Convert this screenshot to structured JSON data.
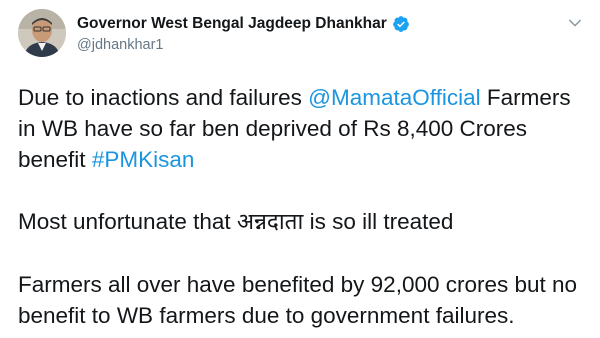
{
  "author": {
    "display_name": "Governor West Bengal Jagdeep Dhankhar",
    "handle": "@jdhankhar1",
    "verified": true
  },
  "icons": {
    "verified": "verified-badge-icon",
    "menu": "chevron-down-icon"
  },
  "colors": {
    "link": "#1b95e0",
    "text": "#14171a",
    "secondary": "#657786",
    "verified": "#1da1f2"
  },
  "tweet": {
    "line1_pre": "Due to inactions and failures ",
    "mention": "@MamataOfficial",
    "line1_post": " Farmers in WB have so far ben deprived of Rs 8,400 Crores benefit ",
    "hashtag": "#PMKisan",
    "para2_pre": "Most unfortunate that ",
    "para2_hindi": "अन्नदाता",
    "para2_post": " is so ill treated",
    "para3": "Farmers all over  have benefited by 92,000 crores but no benefit to WB farmers due to government failures."
  }
}
